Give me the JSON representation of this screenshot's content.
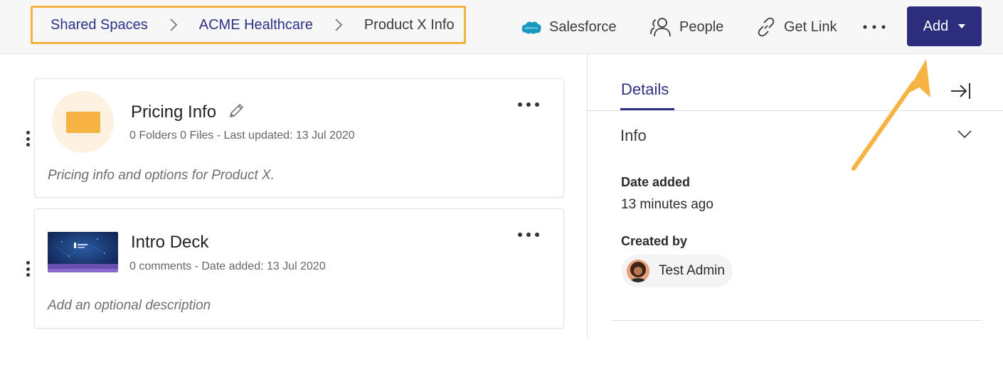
{
  "breadcrumb": {
    "items": [
      "Shared Spaces",
      "ACME Healthcare"
    ],
    "current": "Product X Info"
  },
  "header": {
    "salesforce_label": "Salesforce",
    "people_label": "People",
    "get_link_label": "Get Link",
    "add_label": "Add"
  },
  "items": [
    {
      "title": "Pricing Info",
      "meta": "0 Folders 0 Files - Last updated: 13 Jul 2020",
      "description": "Pricing info and options for Product X."
    },
    {
      "title": "Intro Deck",
      "meta": "0 comments - Date added: 13 Jul 2020",
      "description": "Add an optional description"
    }
  ],
  "details": {
    "tab_label": "Details",
    "section_label": "Info",
    "date_added_label": "Date added",
    "date_added_value": "13 minutes ago",
    "created_by_label": "Created by",
    "created_by_value": "Test Admin"
  },
  "colors": {
    "brand": "#2a2e7c",
    "highlight": "#f5b342",
    "salesforce": "#1798c1"
  },
  "icons": [
    "chevron-right-icon",
    "salesforce-icon",
    "people-icon",
    "link-icon",
    "more-icon",
    "caret-down-icon",
    "pencil-icon",
    "folder-icon",
    "drag-handle-icon",
    "collapse-panel-icon",
    "chevron-down-icon",
    "avatar",
    "annotation-arrow"
  ]
}
